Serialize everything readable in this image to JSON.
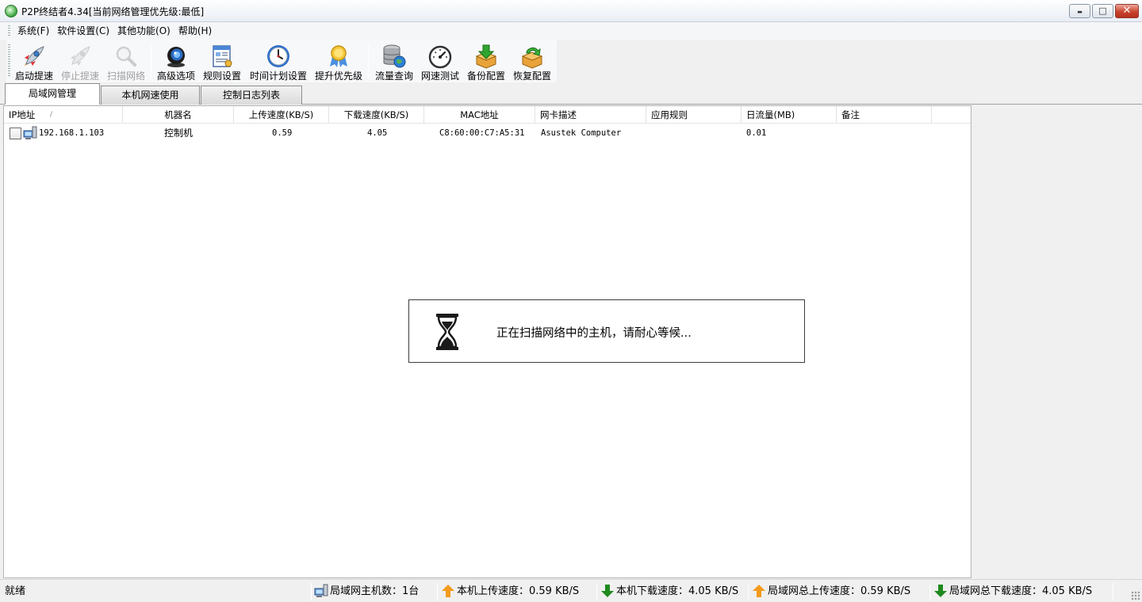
{
  "window": {
    "title": "P2P终结者4.34[当前网络管理优先级:最低]",
    "controls": {
      "minimize": "▬",
      "maximize": "□",
      "close": "✕"
    }
  },
  "menu": [
    "系统(F)",
    "软件设置(C)",
    "其他功能(O)",
    "帮助(H)"
  ],
  "toolbar": [
    {
      "label": "启动提速",
      "icon": "rocket-icon",
      "enabled": true
    },
    {
      "label": "停止提速",
      "icon": "rocket-stop-icon",
      "enabled": false
    },
    {
      "label": "扫描网络",
      "icon": "magnifier-icon",
      "enabled": false
    },
    {
      "label": "高级选项",
      "icon": "webcam-globe-icon",
      "enabled": true
    },
    {
      "label": "规则设置",
      "icon": "rules-document-icon",
      "enabled": true
    },
    {
      "label": "时间计划设置",
      "icon": "clock-icon",
      "enabled": true
    },
    {
      "label": "提升优先级",
      "icon": "award-ribbon-icon",
      "enabled": true
    },
    {
      "label": "流量查询",
      "icon": "database-globe-icon",
      "enabled": true
    },
    {
      "label": "网速测试",
      "icon": "speedometer-icon",
      "enabled": true
    },
    {
      "label": "备份配置",
      "icon": "box-down-arrow-icon",
      "enabled": true
    },
    {
      "label": "恢复配置",
      "icon": "box-recycle-icon",
      "enabled": true
    }
  ],
  "tabs": [
    {
      "label": "局域网管理",
      "active": true
    },
    {
      "label": "本机网速使用",
      "active": false
    },
    {
      "label": "控制日志列表",
      "active": false
    }
  ],
  "table": {
    "columns": [
      "IP地址",
      "机器名",
      "上传速度(KB/S)",
      "下载速度(KB/S)",
      "MAC地址",
      "网卡描述",
      "应用规则",
      "日流量(MB)",
      "备注"
    ],
    "sort_indicator": "/",
    "rows": [
      {
        "ip": "192.168.1.103",
        "name": "控制机",
        "up": "0.59",
        "down": "4.05",
        "mac": "C8:60:00:C7:A5:31",
        "nic": "Asustek Computer",
        "rule": "",
        "daily": "0.01",
        "note": ""
      }
    ]
  },
  "scan_dialog": {
    "message": "正在扫描网络中的主机，请耐心等候..."
  },
  "status": {
    "ready": "就绪",
    "host_count": "局域网主机数：1台",
    "local_up": "本机上传速度：0.59 KB/S",
    "local_down": "本机下载速度：4.05 KB/S",
    "lan_up": "局域网总上传速度：0.59 KB/S",
    "lan_down": "局域网总下载速度：4.05 KB/S"
  },
  "colors": {
    "up_arrow": "#f39a1e",
    "down_arrow": "#1e8a1e",
    "hourglass": "#1a1a1a"
  }
}
